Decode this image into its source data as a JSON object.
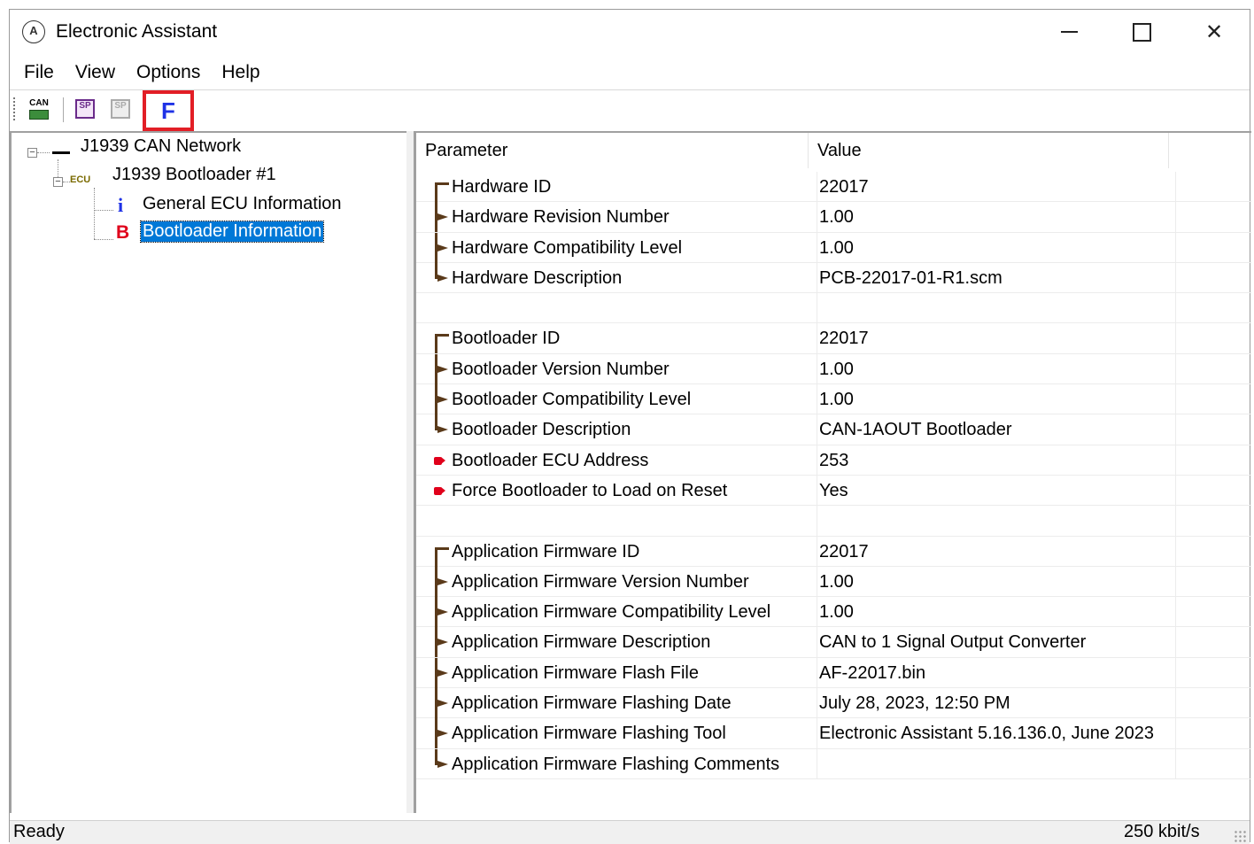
{
  "window": {
    "title": "Electronic Assistant"
  },
  "window_controls": {
    "minimize": "minimize",
    "maximize": "maximize",
    "close": "✕"
  },
  "menu": [
    {
      "label": "File"
    },
    {
      "label": "View"
    },
    {
      "label": "Options"
    },
    {
      "label": "Help"
    }
  ],
  "toolbar": {
    "can_label": "CAN",
    "sp_label": "SP",
    "flash_label": "F"
  },
  "tree": {
    "root": {
      "label": "J1939 CAN Network",
      "expand": "−"
    },
    "ecu": {
      "tag": "ECU",
      "label": "J1939 Bootloader #1",
      "expand": "−"
    },
    "children": [
      {
        "icon": "i",
        "label": "General ECU Information"
      },
      {
        "icon": "B",
        "label": "Bootloader Information",
        "selected": true
      }
    ]
  },
  "table": {
    "columns": [
      "Parameter",
      "Value"
    ],
    "rows": [
      {
        "marker": "top",
        "parameter": "Hardware ID",
        "value": "22017"
      },
      {
        "marker": "mid",
        "parameter": "Hardware Revision Number",
        "value": "1.00"
      },
      {
        "marker": "mid",
        "parameter": "Hardware Compatibility Level",
        "value": "1.00"
      },
      {
        "marker": "bot",
        "parameter": "Hardware Description",
        "value": "PCB-22017-01-R1.scm"
      },
      {
        "marker": "",
        "parameter": "",
        "value": ""
      },
      {
        "marker": "top",
        "parameter": "Bootloader ID",
        "value": "22017"
      },
      {
        "marker": "mid",
        "parameter": "Bootloader Version Number",
        "value": "1.00"
      },
      {
        "marker": "mid",
        "parameter": "Bootloader Compatibility Level",
        "value": "1.00"
      },
      {
        "marker": "bot",
        "parameter": "Bootloader Description",
        "value": "CAN-1AOUT Bootloader"
      },
      {
        "marker": "red",
        "parameter": "Bootloader ECU Address",
        "value": "253"
      },
      {
        "marker": "red",
        "parameter": "Force Bootloader to Load on Reset",
        "value": "Yes"
      },
      {
        "marker": "",
        "parameter": "",
        "value": ""
      },
      {
        "marker": "top",
        "parameter": "Application Firmware ID",
        "value": "22017"
      },
      {
        "marker": "mid",
        "parameter": "Application Firmware Version Number",
        "value": "1.00"
      },
      {
        "marker": "mid",
        "parameter": "Application Firmware Compatibility Level",
        "value": "1.00"
      },
      {
        "marker": "mid",
        "parameter": "Application Firmware Description",
        "value": "CAN to 1 Signal Output Converter"
      },
      {
        "marker": "mid",
        "parameter": "Application Firmware Flash File",
        "value": "AF-22017.bin"
      },
      {
        "marker": "mid",
        "parameter": "Application Firmware Flashing Date",
        "value": "July 28, 2023, 12:50 PM"
      },
      {
        "marker": "mid",
        "parameter": "Application Firmware Flashing Tool",
        "value": "Electronic Assistant 5.16.136.0, June 2023"
      },
      {
        "marker": "bot",
        "parameter": "Application Firmware Flashing Comments",
        "value": ""
      }
    ]
  },
  "status": {
    "left": "Ready",
    "right": "250 kbit/s"
  },
  "colors": {
    "selection": "#0078d7",
    "highlight_box": "#e21e26",
    "flash_icon": "#1f32e6",
    "marker_red": "#e0001b",
    "tree_info_icon": "#1f32e6",
    "tree_b_icon": "#e0001b"
  }
}
